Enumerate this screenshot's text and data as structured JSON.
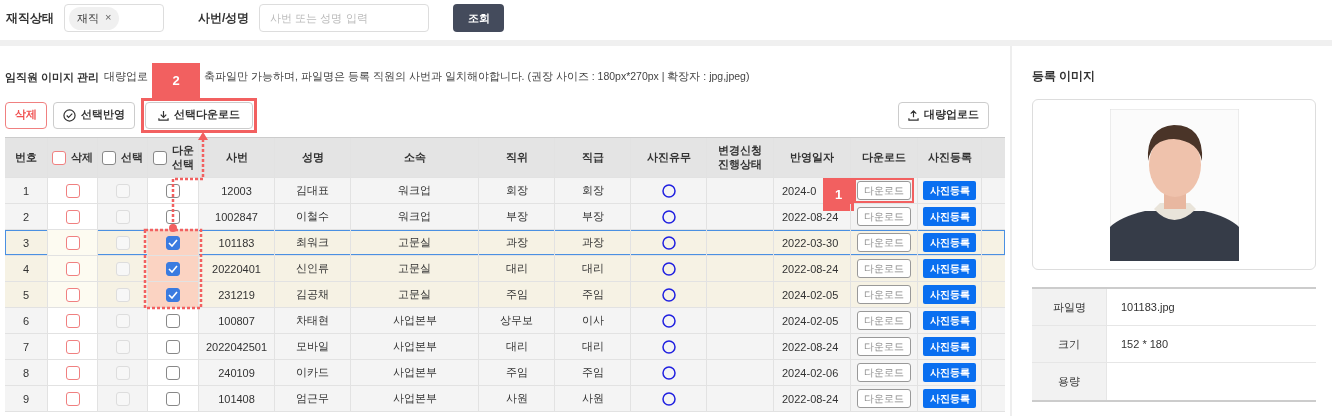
{
  "filter": {
    "status_label": "재직상태",
    "status_chip": "재직",
    "chip_remove": "×",
    "id_label": "사번/성명",
    "id_placeholder": "사번 또는 성명 입력",
    "search_button": "조회"
  },
  "section": {
    "title": "임직원 이미지 관리",
    "desc_before": "대량업로",
    "desc_after": "축파일만 가능하며, 파일명은 등록 직원의 사번과 일치해야합니다. (권장 사이즈 : 180px*270px | 확장자 : jpg,jpeg)"
  },
  "actions": {
    "delete": "삭제",
    "apply": "선택반영",
    "download": "선택다운로드",
    "download_callout": "2",
    "upload": "대량업로드"
  },
  "table": {
    "columns": [
      {
        "label": "번호",
        "kind": "text"
      },
      {
        "label": "삭제",
        "kind": "delete",
        "checked": false
      },
      {
        "label": "선택",
        "kind": "select",
        "checked": false
      },
      {
        "label": "다운\n선택",
        "kind": "down",
        "checked": false
      },
      {
        "label": "사번",
        "kind": "text"
      },
      {
        "label": "성명",
        "kind": "text"
      },
      {
        "label": "소속",
        "kind": "text"
      },
      {
        "label": "직위",
        "kind": "text"
      },
      {
        "label": "직급",
        "kind": "text"
      },
      {
        "label": "사진유무",
        "kind": "text"
      },
      {
        "label": "변경신청\n진행상태",
        "kind": "text"
      },
      {
        "label": "반영일자",
        "kind": "text"
      },
      {
        "label": "다운로드",
        "kind": "text"
      },
      {
        "label": "사진등록",
        "kind": "text"
      }
    ],
    "rows": [
      {
        "no": "1",
        "deleted": false,
        "picked": false,
        "down": false,
        "selected": false,
        "id": "12003",
        "name": "김대표",
        "dept": "워크업",
        "position": "회장",
        "rank": "회장",
        "has_photo": true,
        "date": "2024-0",
        "callout": "1",
        "download_label": "다운로드",
        "register_label": "사진등록"
      },
      {
        "no": "2",
        "deleted": false,
        "picked": false,
        "down": false,
        "selected": false,
        "id": "1002847",
        "name": "이철수",
        "dept": "워크업",
        "position": "부장",
        "rank": "부장",
        "has_photo": true,
        "date": "2022-08-24",
        "download_label": "다운로드",
        "register_label": "사진등록"
      },
      {
        "no": "3",
        "deleted": false,
        "picked": false,
        "down": true,
        "selected": true,
        "id": "101183",
        "name": "최워크",
        "dept": "고문실",
        "position": "과장",
        "rank": "과장",
        "has_photo": true,
        "date": "2022-03-30",
        "download_label": "다운로드",
        "register_label": "사진등록"
      },
      {
        "no": "4",
        "deleted": false,
        "picked": false,
        "down": true,
        "selected": false,
        "id": "20220401",
        "name": "신인류",
        "dept": "고문실",
        "position": "대리",
        "rank": "대리",
        "has_photo": true,
        "date": "2022-08-24",
        "download_label": "다운로드",
        "register_label": "사진등록"
      },
      {
        "no": "5",
        "deleted": false,
        "picked": false,
        "down": true,
        "selected": false,
        "id": "231219",
        "name": "김공채",
        "dept": "고문실",
        "position": "주임",
        "rank": "주임",
        "has_photo": true,
        "date": "2024-02-05",
        "download_label": "다운로드",
        "register_label": "사진등록"
      },
      {
        "no": "6",
        "deleted": false,
        "picked": false,
        "down": false,
        "selected": false,
        "id": "100807",
        "name": "차태현",
        "dept": "사업본부",
        "position": "상무보",
        "rank": "이사",
        "has_photo": true,
        "date": "2024-02-05",
        "download_label": "다운로드",
        "register_label": "사진등록"
      },
      {
        "no": "7",
        "deleted": false,
        "picked": false,
        "down": false,
        "selected": false,
        "id": "2022042501",
        "name": "모바일",
        "dept": "사업본부",
        "position": "대리",
        "rank": "대리",
        "has_photo": true,
        "date": "2022-08-24",
        "download_label": "다운로드",
        "register_label": "사진등록"
      },
      {
        "no": "8",
        "deleted": false,
        "picked": false,
        "down": false,
        "selected": false,
        "id": "240109",
        "name": "이카드",
        "dept": "사업본부",
        "position": "주임",
        "rank": "주임",
        "has_photo": true,
        "date": "2024-02-06",
        "download_label": "다운로드",
        "register_label": "사진등록"
      },
      {
        "no": "9",
        "deleted": false,
        "picked": false,
        "down": false,
        "selected": false,
        "id": "101408",
        "name": "엄근무",
        "dept": "사업본부",
        "position": "사원",
        "rank": "사원",
        "has_photo": true,
        "date": "2022-08-24",
        "download_label": "다운로드",
        "register_label": "사진등록"
      }
    ]
  },
  "panel": {
    "title": "등록 이미지",
    "info": [
      {
        "label": "파일명",
        "value": "101183.jpg"
      },
      {
        "label": "크기",
        "value": "152 * 180"
      },
      {
        "label": "용량"
      }
    ]
  }
}
